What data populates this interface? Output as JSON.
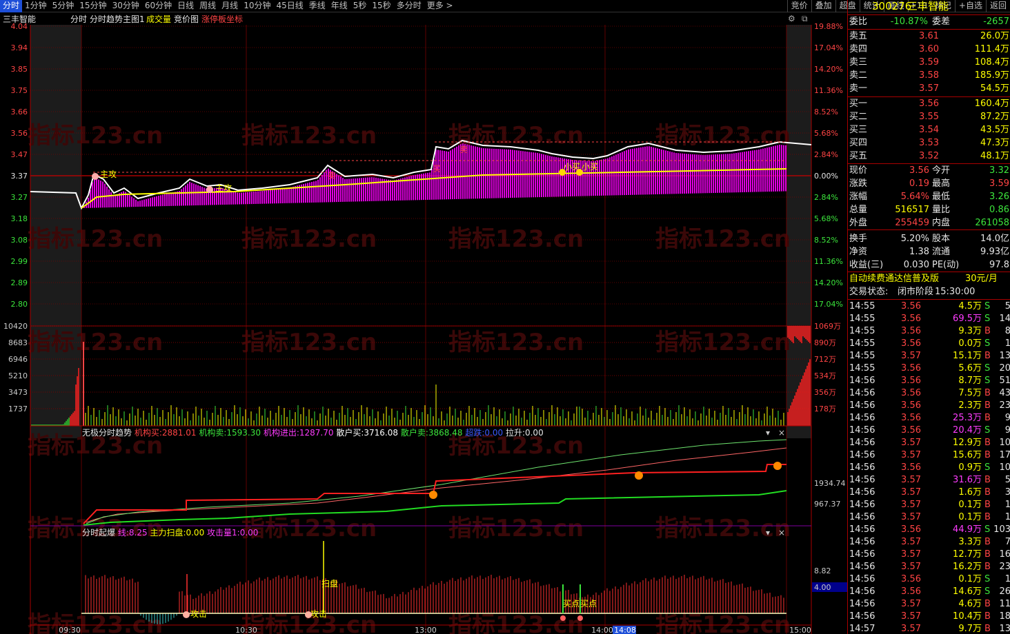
{
  "top_tabs": [
    "分时",
    "1分钟",
    "5分钟",
    "15分钟",
    "30分钟",
    "60分钟",
    "日线",
    "周线",
    "月线",
    "10分钟",
    "45日线",
    "季线",
    "年线",
    "5秒",
    "15秒",
    "多分时",
    "更多 >"
  ],
  "right_tabs": [
    "竞价",
    "叠加",
    "超盘",
    "统计",
    "画线",
    "F10",
    "标记",
    "+自选",
    "返回"
  ],
  "chart": {
    "header": {
      "name": "三丰智能",
      "mode": "分时",
      "title": "分时趋势主图1",
      "item1": "成交量",
      "item2": "竞价图",
      "item3": "涨停板坐标"
    },
    "price_ticks": [
      "4.04",
      "3.94",
      "3.85",
      "3.75",
      "3.66",
      "3.56",
      "3.47",
      "3.37",
      "3.27",
      "3.18",
      "3.08",
      "2.99",
      "2.89",
      "2.80"
    ],
    "pct_ticks": [
      "19.88%",
      "17.04%",
      "14.20%",
      "11.36%",
      "8.52%",
      "5.68%",
      "2.84%",
      "0.00%",
      "2.84%",
      "5.68%",
      "8.52%",
      "11.36%",
      "14.20%",
      "17.04%"
    ],
    "vol_ticks_left": [
      "10420",
      "8683",
      "6946",
      "5210",
      "3473",
      "1737"
    ],
    "vol_ticks_right": [
      "1069万",
      "890万",
      "712万",
      "534万",
      "356万",
      "178万"
    ],
    "price_labels": [
      "主攻",
      "主攻",
      "买",
      "卖",
      "卖",
      "小买",
      "小买"
    ],
    "ind1": {
      "name": "无极分时趋势",
      "l1": "机构买:",
      "v1": "2881.01",
      "l2": "机构卖:",
      "v2": "1593.30",
      "l3": "机构进出:",
      "v3": "1287.70",
      "l4": "散户买:",
      "v4": "3716.08",
      "l5": "散户卖:",
      "v5": "3868.48",
      "l6": "超跌:",
      "v6": "0.00",
      "l7": "拉升:",
      "v7": "0.00",
      "r1": "1934.74",
      "r2": "967.37"
    },
    "ind2": {
      "name": "分时起爆",
      "l1": "线:",
      "v1": "8.25",
      "l2": "主力扫盘:",
      "v2": "0.00",
      "l3": "攻击量1:",
      "v3": "0.00",
      "r1": "8.82",
      "r2": "4.00",
      "mk1": "攻击",
      "mk2": "攻击",
      "mk3": "扫盘",
      "mk4": "买点",
      "mk5": "买点"
    },
    "time_labels": [
      "09:30",
      "10:30",
      "13:00",
      "14:00",
      "14:08",
      "15:00"
    ],
    "watermark": "指标123.cn"
  },
  "side": {
    "code": "300276",
    "name": "三丰智能",
    "weibi_label": "委比",
    "weibi": "-10.87%",
    "weicha_label": "委差",
    "weicha": "-2657",
    "sells": [
      {
        "l": "卖五",
        "p": "3.61",
        "v": "26.0万"
      },
      {
        "l": "卖四",
        "p": "3.60",
        "v": "111.4万"
      },
      {
        "l": "卖三",
        "p": "3.59",
        "v": "108.4万"
      },
      {
        "l": "卖二",
        "p": "3.58",
        "v": "185.9万"
      },
      {
        "l": "卖一",
        "p": "3.57",
        "v": "54.5万"
      }
    ],
    "buys": [
      {
        "l": "买一",
        "p": "3.56",
        "v": "160.4万"
      },
      {
        "l": "买二",
        "p": "3.55",
        "v": "87.2万"
      },
      {
        "l": "买三",
        "p": "3.54",
        "v": "43.5万"
      },
      {
        "l": "买四",
        "p": "3.53",
        "v": "47.3万"
      },
      {
        "l": "买五",
        "p": "3.52",
        "v": "48.1万"
      }
    ],
    "stats": [
      {
        "a": "现价",
        "av": "3.56",
        "ac": "red",
        "b": "今开",
        "bv": "3.32",
        "bc": "green"
      },
      {
        "a": "涨跌",
        "av": "0.19",
        "ac": "red",
        "b": "最高",
        "bv": "3.59",
        "bc": "red"
      },
      {
        "a": "涨幅",
        "av": "5.64%",
        "ac": "red",
        "b": "最低",
        "bv": "3.26",
        "bc": "green"
      },
      {
        "a": "总量",
        "av": "516517",
        "ac": "yellow",
        "b": "量比",
        "bv": "0.86",
        "bc": "green"
      },
      {
        "a": "外盘",
        "av": "255459",
        "ac": "red",
        "b": "内盘",
        "bv": "261058",
        "bc": "green"
      },
      {
        "a": "换手",
        "av": "5.20%",
        "ac": "white",
        "b": "股本",
        "bv": "14.0亿",
        "bc": "white"
      },
      {
        "a": "净资",
        "av": "1.38",
        "ac": "white",
        "b": "流通",
        "bv": "9.93亿",
        "bc": "white"
      },
      {
        "a": "收益(三)",
        "av": "0.030",
        "ac": "white",
        "b": "PE(动)",
        "bv": "97.8",
        "bc": "white"
      }
    ],
    "promo": "自动续费通达信普及版",
    "promo_price": "30元/月",
    "status_label": "交易状态:",
    "status": "闭市阶段",
    "status_time": "15:30:00",
    "trades": [
      [
        "14:55",
        "3.56",
        "4.5万",
        "S",
        "5"
      ],
      [
        "14:55",
        "3.56",
        "69.5万",
        "S",
        "14"
      ],
      [
        "14:55",
        "3.56",
        "9.3万",
        "B",
        "8"
      ],
      [
        "14:55",
        "3.56",
        "0.0万",
        "S",
        "1"
      ],
      [
        "14:55",
        "3.57",
        "15.1万",
        "B",
        "13"
      ],
      [
        "14:55",
        "3.56",
        "5.6万",
        "S",
        "20"
      ],
      [
        "14:56",
        "3.56",
        "8.7万",
        "S",
        "51"
      ],
      [
        "14:56",
        "3.56",
        "7.5万",
        "B",
        "43"
      ],
      [
        "14:56",
        "3.56",
        "2.3万",
        "B",
        "23"
      ],
      [
        "14:56",
        "3.56",
        "25.3万",
        "B",
        "9"
      ],
      [
        "14:56",
        "3.56",
        "20.4万",
        "S",
        "9"
      ],
      [
        "14:56",
        "3.57",
        "12.9万",
        "B",
        "10"
      ],
      [
        "14:56",
        "3.57",
        "15.6万",
        "B",
        "17"
      ],
      [
        "14:56",
        "3.56",
        "0.9万",
        "S",
        "10"
      ],
      [
        "14:56",
        "3.57",
        "31.6万",
        "B",
        "5"
      ],
      [
        "14:56",
        "3.57",
        "1.6万",
        "B",
        "3"
      ],
      [
        "14:56",
        "3.57",
        "0.1万",
        "B",
        "1"
      ],
      [
        "14:56",
        "3.57",
        "0.1万",
        "B",
        "1"
      ],
      [
        "14:56",
        "3.56",
        "44.9万",
        "S",
        "103"
      ],
      [
        "14:56",
        "3.57",
        "3.3万",
        "B",
        "7"
      ],
      [
        "14:56",
        "3.57",
        "12.7万",
        "B",
        "16"
      ],
      [
        "14:56",
        "3.57",
        "16.2万",
        "B",
        "23"
      ],
      [
        "14:56",
        "3.56",
        "0.1万",
        "S",
        "1"
      ],
      [
        "14:56",
        "3.56",
        "14.6万",
        "S",
        "26"
      ],
      [
        "14:56",
        "3.57",
        "4.6万",
        "B",
        "11"
      ],
      [
        "14:56",
        "3.57",
        "10.4万",
        "B",
        "18"
      ],
      [
        "14:57",
        "3.57",
        "9.7万",
        "B",
        "13"
      ]
    ]
  }
}
